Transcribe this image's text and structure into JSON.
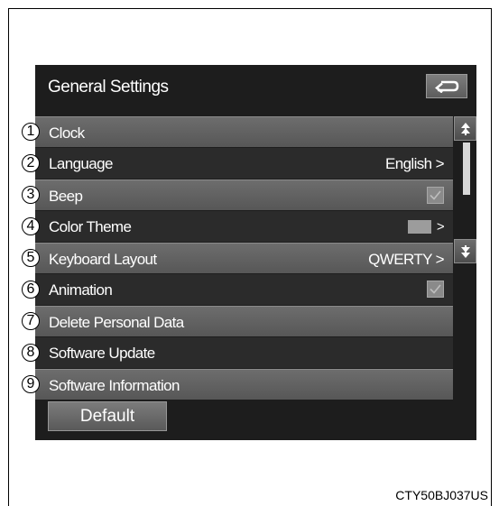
{
  "screen": {
    "title": "General Settings",
    "back_icon": "return-arrow-icon"
  },
  "rows": [
    {
      "num": "1",
      "label": "Clock",
      "value": ""
    },
    {
      "num": "2",
      "label": "Language",
      "value": "English"
    },
    {
      "num": "3",
      "label": "Beep",
      "value": ""
    },
    {
      "num": "4",
      "label": "Color Theme",
      "value": ""
    },
    {
      "num": "5",
      "label": "Keyboard Layout",
      "value": "QWERTY"
    },
    {
      "num": "6",
      "label": "Animation",
      "value": ""
    },
    {
      "num": "7",
      "label": "Delete Personal Data",
      "value": ""
    },
    {
      "num": "8",
      "label": "Software Update",
      "value": ""
    },
    {
      "num": "9",
      "label": "Software Information",
      "value": ""
    }
  ],
  "chevron": ">",
  "default_button": "Default",
  "caption": "CTY50BJ037US",
  "colors": {
    "screen_bg": "#1d1d1d",
    "row_light": "#626262",
    "row_dark": "#2b2b2b",
    "text": "#ffffff"
  }
}
